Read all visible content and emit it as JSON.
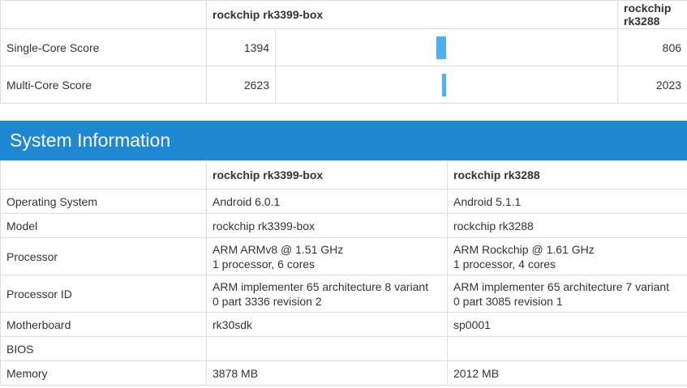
{
  "devices": {
    "a": "rockchip rk3399-box",
    "b": "rockchip rk3288"
  },
  "scores": [
    {
      "label": "Single-Core Score",
      "a": "1394",
      "b": "806",
      "a_value": 1394,
      "b_value": 806
    },
    {
      "label": "Multi-Core Score",
      "a": "2623",
      "b": "2023",
      "a_value": 2623,
      "b_value": 2023
    }
  ],
  "section_title": "System Information",
  "system": [
    {
      "label": "Operating System",
      "a": [
        "Android 6.0.1"
      ],
      "b": [
        "Android 5.1.1"
      ]
    },
    {
      "label": "Model",
      "a": [
        "rockchip rk3399-box"
      ],
      "b": [
        "rockchip rk3288"
      ]
    },
    {
      "label": "Processor",
      "a": [
        "ARM ARMv8 @ 1.51 GHz",
        "1 processor, 6 cores"
      ],
      "b": [
        "ARM Rockchip @ 1.61 GHz",
        "1 processor, 4 cores"
      ]
    },
    {
      "label": "Processor ID",
      "a": [
        "ARM implementer 65 architecture 8 variant",
        "0 part 3336 revision 2"
      ],
      "b": [
        "ARM implementer 65 architecture 7 variant",
        "0 part 3085 revision 1"
      ]
    },
    {
      "label": "Motherboard",
      "a": [
        "rk30sdk"
      ],
      "b": [
        "sp0001"
      ]
    },
    {
      "label": "BIOS",
      "a": [
        ""
      ],
      "b": [
        ""
      ]
    },
    {
      "label": "Memory",
      "a": [
        "3878 MB"
      ],
      "b": [
        "2012 MB"
      ]
    }
  ],
  "colors": {
    "bar": "#50b0f6",
    "header_bg": "#1e88d2"
  }
}
